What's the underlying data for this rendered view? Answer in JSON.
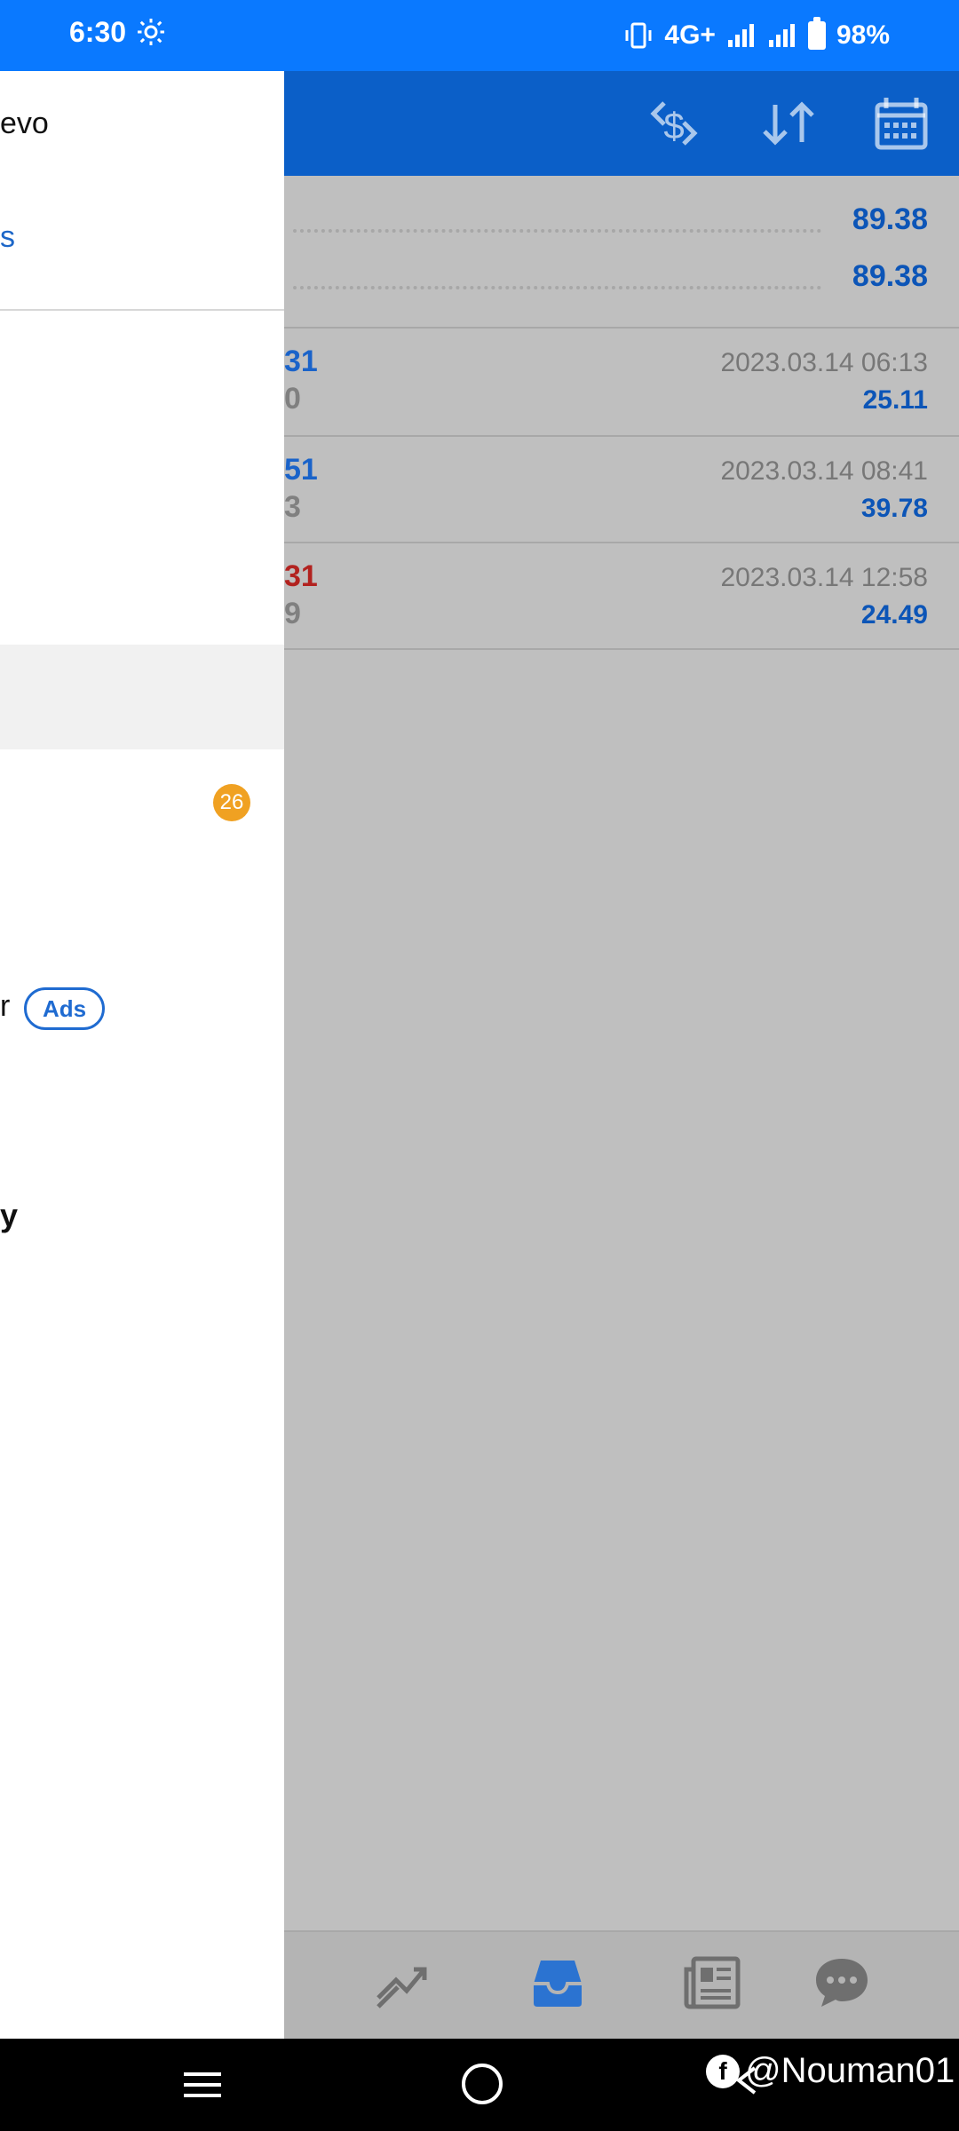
{
  "status_bar": {
    "time": "6:30",
    "network": "4G+",
    "battery": "98%",
    "icons": [
      "settings-gear-icon",
      "vibrate-icon",
      "signal-icon",
      "signal-icon",
      "battery-icon"
    ]
  },
  "header": {
    "icons": [
      "currency-exchange-icon",
      "sort-icon",
      "calendar-icon"
    ]
  },
  "drawer": {
    "text_top": "evo",
    "text_link": "s",
    "badge": "26",
    "item_r": "r",
    "ads_badge": "Ads",
    "item_y": "y"
  },
  "summary": [
    {
      "value": "89.38"
    },
    {
      "value": "89.38"
    }
  ],
  "trades": [
    {
      "left_top": "31",
      "left_bottom": "0",
      "time": "2023.03.14 06:13",
      "profit": "25.11",
      "left_color": "#1a63c9"
    },
    {
      "left_top": "51",
      "left_bottom": "3",
      "time": "2023.03.14 08:41",
      "profit": "39.78",
      "left_color": "#1a63c9"
    },
    {
      "left_top": "31",
      "left_bottom": "9",
      "time": "2023.03.14 12:58",
      "profit": "24.49",
      "left_color": "#b2221f"
    }
  ],
  "bottom_nav": {
    "icons": [
      "trade-chart-icon",
      "inbox-icon",
      "news-icon",
      "chat-icon"
    ]
  },
  "system_nav": {
    "icons": [
      "menu-icon",
      "home-icon",
      "back-icon"
    ]
  },
  "watermark": {
    "brand_icon": "facebook-icon",
    "text": "@Nouman01"
  },
  "colors": {
    "status_bar": "#0a79ff",
    "app_header": "#0b5fc8",
    "overlay": "#bfbfbf",
    "accent": "#0c55b7",
    "badge": "#f0a122",
    "negative": "#b2221f"
  }
}
